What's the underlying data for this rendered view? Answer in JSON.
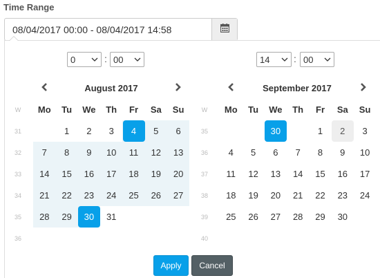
{
  "field": {
    "label": "Time Range",
    "value": "08/04/2017 00:00 - 08/04/2017 14:58",
    "calendar_icon": "calendar-icon"
  },
  "left": {
    "hour": "0",
    "minute": "00",
    "month_title": "August 2017",
    "weekday_header": [
      "W",
      "Mo",
      "Tu",
      "We",
      "Th",
      "Fr",
      "Sa",
      "Su"
    ],
    "weeks": [
      {
        "wk": "31",
        "days": [
          "",
          "1",
          "2",
          "3",
          "4",
          "5",
          "6"
        ]
      },
      {
        "wk": "32",
        "days": [
          "7",
          "8",
          "9",
          "10",
          "11",
          "12",
          "13"
        ]
      },
      {
        "wk": "33",
        "days": [
          "14",
          "15",
          "16",
          "17",
          "18",
          "19",
          "20"
        ]
      },
      {
        "wk": "34",
        "days": [
          "21",
          "22",
          "23",
          "24",
          "25",
          "26",
          "27"
        ]
      },
      {
        "wk": "35",
        "days": [
          "28",
          "29",
          "30",
          "31",
          "",
          "",
          ""
        ]
      },
      {
        "wk": "36",
        "days": [
          "",
          "",
          "",
          "",
          "",
          "",
          ""
        ]
      }
    ]
  },
  "right": {
    "hour": "14",
    "minute": "00",
    "month_title": "September 2017",
    "weekday_header": [
      "W",
      "Mo",
      "Tu",
      "We",
      "Th",
      "Fr",
      "Sa",
      "Su"
    ],
    "weeks": [
      {
        "wk": "35",
        "days": [
          "",
          "",
          "30",
          "",
          "1",
          "2",
          "3"
        ]
      },
      {
        "wk": "36",
        "days": [
          "4",
          "5",
          "6",
          "7",
          "8",
          "9",
          "10"
        ]
      },
      {
        "wk": "37",
        "days": [
          "11",
          "12",
          "13",
          "14",
          "15",
          "16",
          "17"
        ]
      },
      {
        "wk": "38",
        "days": [
          "18",
          "19",
          "20",
          "21",
          "22",
          "23",
          "24"
        ]
      },
      {
        "wk": "39",
        "days": [
          "25",
          "26",
          "27",
          "28",
          "29",
          "30",
          ""
        ]
      },
      {
        "wk": "40",
        "days": [
          "",
          "",
          "",
          "",
          "",
          "",
          ""
        ]
      }
    ]
  },
  "buttons": {
    "apply": "Apply",
    "cancel": "Cancel"
  },
  "colors": {
    "accent": "#08a0e9",
    "range_highlight": "#ebf4f8",
    "cancel_bg": "#546065"
  }
}
